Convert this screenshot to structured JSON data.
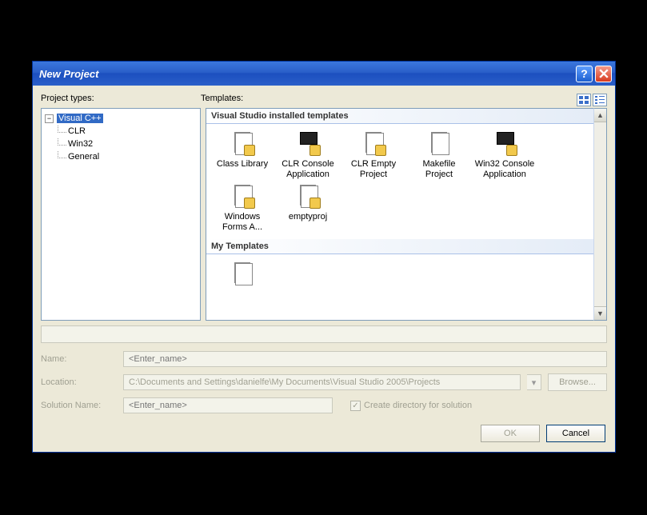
{
  "titlebar": {
    "title": "New Project"
  },
  "labels": {
    "project_types": "Project types:",
    "templates": "Templates:"
  },
  "tree": {
    "root": "Visual C++",
    "children": [
      "CLR",
      "Win32",
      "General"
    ]
  },
  "template_groups": {
    "installed": "Visual Studio installed templates",
    "my": "My Templates"
  },
  "templates_installed": [
    {
      "label": "Class Library"
    },
    {
      "label": "CLR Console Application"
    },
    {
      "label": "CLR Empty Project"
    },
    {
      "label": "Makefile Project"
    },
    {
      "label": "Win32 Console Application"
    },
    {
      "label": "Windows Forms A..."
    },
    {
      "label": "emptyproj"
    }
  ],
  "form": {
    "name_label": "Name:",
    "name_placeholder": "<Enter_name>",
    "location_label": "Location:",
    "location_value": "C:\\Documents and Settings\\danielfe\\My Documents\\Visual Studio 2005\\Projects",
    "browse_label": "Browse...",
    "solution_label": "Solution Name:",
    "solution_placeholder": "<Enter_name>",
    "create_dir_label": "Create directory for solution",
    "create_dir_checked": true
  },
  "buttons": {
    "ok": "OK",
    "cancel": "Cancel"
  }
}
